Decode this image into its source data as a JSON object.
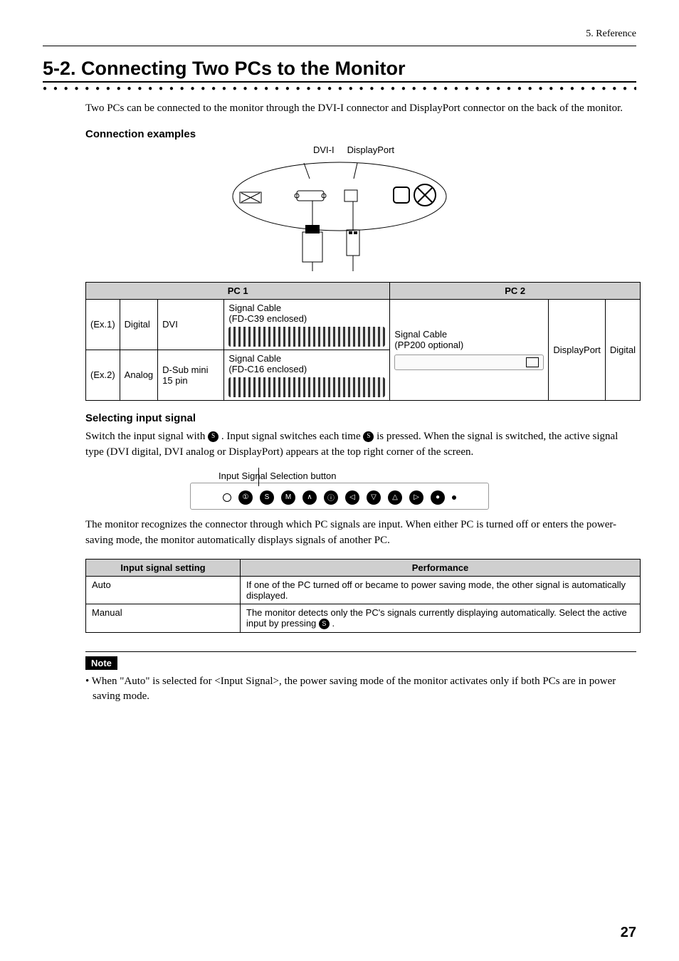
{
  "header": {
    "section": "5. Reference"
  },
  "title": "5-2. Connecting Two PCs to the Monitor",
  "intro": "Two PCs can be connected to the monitor through the DVI-I connector and DisplayPort connector on the back of the monitor.",
  "subheads": {
    "conn_examples": "Connection examples",
    "select_input": "Selecting input signal"
  },
  "port_labels": {
    "dvi": "DVI-I",
    "dp": "DisplayPort"
  },
  "conn_table": {
    "pc1": "PC 1",
    "pc2": "PC 2",
    "rows": [
      {
        "ex": "(Ex.1)",
        "mode": "Digital",
        "conn": "DVI",
        "cable_line1": "Signal Cable",
        "cable_line2": "(FD-C39 enclosed)"
      },
      {
        "ex": "(Ex.2)",
        "mode": "Analog",
        "conn": "D-Sub mini 15 pin",
        "cable_line1": "Signal Cable",
        "cable_line2": "(FD-C16 enclosed)"
      }
    ],
    "pc2_cable_line1": "Signal Cable",
    "pc2_cable_line2": "(PP200 optional)",
    "pc2_conn": "DisplayPort",
    "pc2_mode": "Digital"
  },
  "select_text_pre": "Switch the input signal with ",
  "select_text_mid": ". Input signal switches each time ",
  "select_text_post": " is pressed. When the signal is switched, the active signal type (DVI digital, DVI analog or DisplayPort) appears at the top right corner of the screen.",
  "button_caption": "Input Signal Selection button",
  "panel_glyphs": [
    "①",
    "S",
    "M",
    "∧",
    "ⓘ",
    "◁",
    "▽",
    "△",
    "▷",
    "●"
  ],
  "recognize_text": "The monitor recognizes the connector through which PC signals are input. When either PC is turned off or enters the power-saving mode, the monitor automatically displays signals of another PC.",
  "perf_table": {
    "h1": "Input signal setting",
    "h2": "Performance",
    "rows": [
      {
        "setting": "Auto",
        "perf": "If one of the PC turned off or became to power saving mode, the other signal is automatically displayed."
      },
      {
        "setting": "Manual",
        "perf_pre": "The monitor detects only the PC's signals currently displaying automatically. Select the active input by pressing ",
        "perf_post": "."
      }
    ]
  },
  "note": {
    "label": "Note",
    "text": "• When \"Auto\" is selected for <Input Signal>, the power saving mode of the monitor activates only if both PCs are in power saving mode."
  },
  "page_number": "27"
}
